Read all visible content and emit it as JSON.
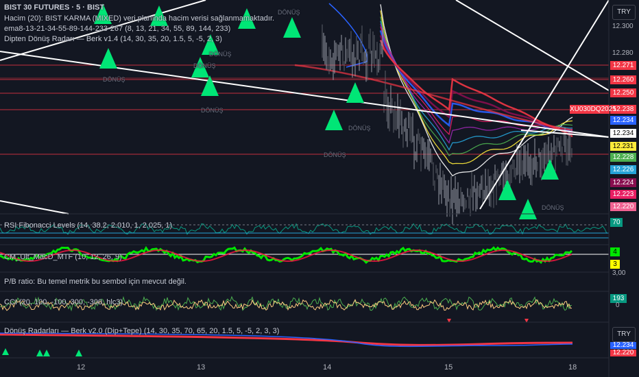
{
  "header": {
    "symbol": "BIST 30 FUTURES · 5 · BIST",
    "indicators": [
      "Hacim (20): BIST KARMA (MIXED) veri planında hacim verisi sağlanmamaktadır.",
      "ema8-13-21-34-55-89-144-233-267 (8, 13, 21, 34, 55, 89, 144, 233)",
      "Dipten Dönüş Radarı — Berk v1.4 (14, 30, 35, 20, 1.5, 5, -5, 2, 3)"
    ]
  },
  "panes": {
    "rsi_label": "RSI Fibonacci Levels (14, 38.2, 2.010, 1, 2.025, 1)",
    "rsi_value": "70",
    "macd_label": "CM_Ult_MacD_MTF (10, 12, 26, 9)",
    "macd_values": [
      "4",
      "3"
    ],
    "pb_label": "P/B ratio: Bu temel metrik bu sembol için mevcut değil.",
    "pb_axis": "3,00",
    "cci_label": "CCI (20, 100, -100, 300, -300, hlc3)",
    "cci_value": "193",
    "cci_axis": "0",
    "donus_label": "Dönüş Radarları — Berk v2.0 (Dip+Tepe) (14, 30, 35, 70, 65, 20, 1.5, 5, -5, 2, 3, 3)",
    "donus_tags": [
      "12.234",
      "12.220"
    ]
  },
  "signal_text": "DÖNÜŞ",
  "currency": "TRY",
  "price_axis": [
    "12.300",
    "12.280"
  ],
  "price_tags": [
    {
      "text": "12.271",
      "color": "#f23645"
    },
    {
      "text": "12.260",
      "color": "#f23645"
    },
    {
      "text": "12.250",
      "color": "#f23645"
    },
    {
      "text": "12.238",
      "color": "#f23645"
    },
    {
      "text": "12.234",
      "color": "#2962ff"
    },
    {
      "text": "12.234",
      "color": "#ffffff"
    },
    {
      "text": "12.231",
      "color": "#ffeb3b"
    },
    {
      "text": "12.228",
      "color": "#4caf50"
    },
    {
      "text": "12.226",
      "color": "#26a3d8"
    },
    {
      "text": "12.224",
      "color": "#880e4f"
    },
    {
      "text": "12.223",
      "color": "#e91e63"
    },
    {
      "text": "12.220",
      "color": "#f06292"
    }
  ],
  "symbol_tag": "XU030DQ2025",
  "x_ticks": [
    "12",
    "13",
    "14",
    "15",
    "18"
  ]
}
